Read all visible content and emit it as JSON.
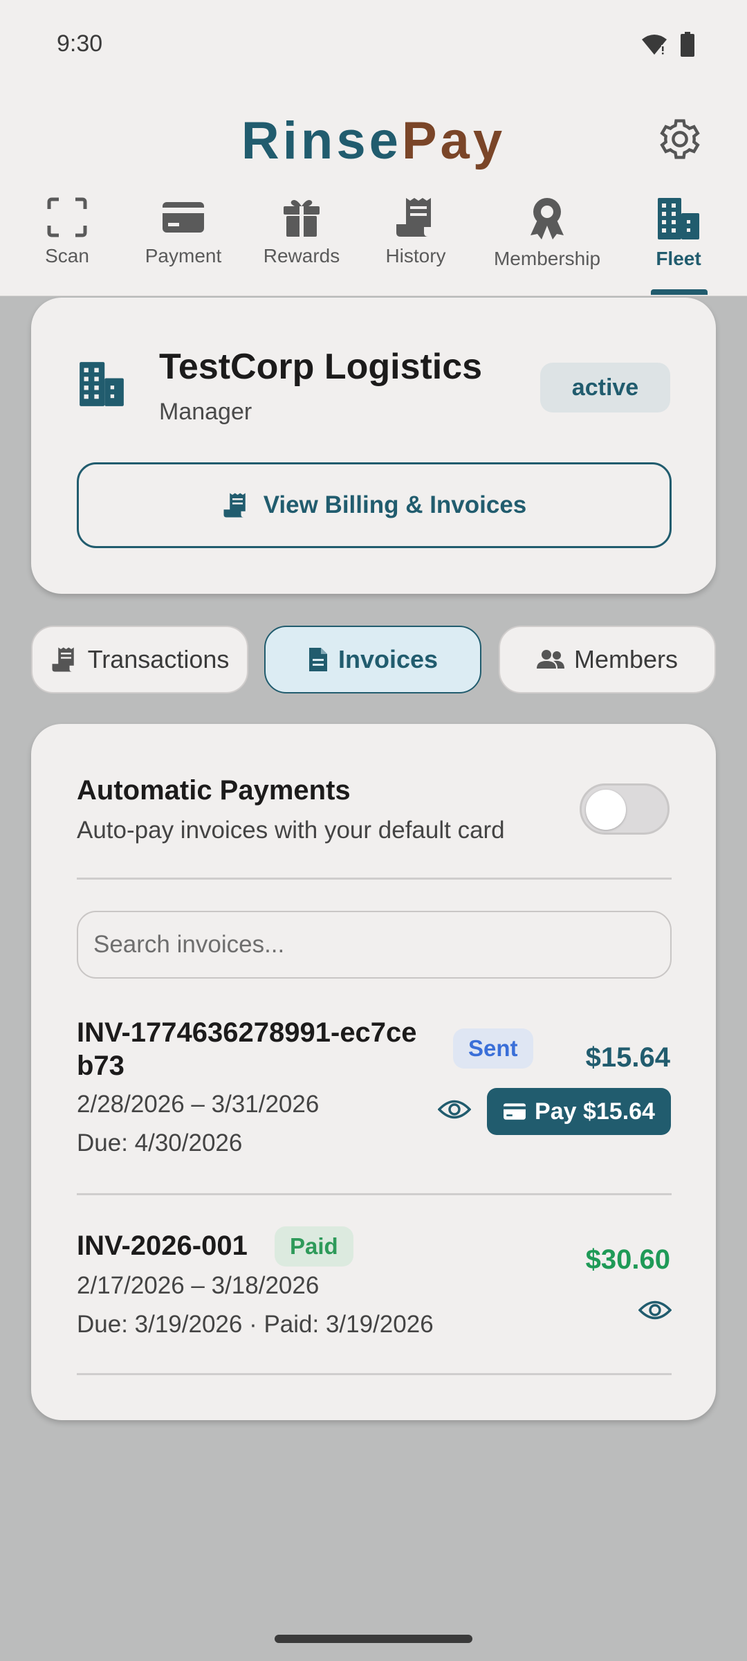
{
  "status_bar": {
    "time": "9:30"
  },
  "brand": {
    "part1": "Rinse",
    "part2": "Pay"
  },
  "nav": [
    {
      "label": "Scan",
      "icon": "scan-icon",
      "active": false
    },
    {
      "label": "Payment",
      "icon": "card-icon",
      "active": false
    },
    {
      "label": "Rewards",
      "icon": "gift-icon",
      "active": false
    },
    {
      "label": "History",
      "icon": "receipt-icon",
      "active": false
    },
    {
      "label": "Membership",
      "icon": "badge-icon",
      "active": false
    },
    {
      "label": "Fleet",
      "icon": "building-icon",
      "active": true
    }
  ],
  "fleet": {
    "company": "TestCorp Logistics",
    "role": "Manager",
    "status": "active",
    "billing_button": "View Billing & Invoices"
  },
  "segments": [
    {
      "label": "Transactions",
      "active": false
    },
    {
      "label": "Invoices",
      "active": true
    },
    {
      "label": "Members",
      "active": false
    }
  ],
  "auto_pay": {
    "title": "Automatic Payments",
    "subtitle": "Auto-pay invoices with your default card",
    "enabled": false
  },
  "search": {
    "placeholder": "Search invoices..."
  },
  "invoices": [
    {
      "id_line1": "INV-1774636278991-ec7ce",
      "id_line2": "b73",
      "status": "Sent",
      "amount": "$15.64",
      "period": "2/28/2026 – 3/31/2026",
      "due": "Due: 4/30/2026",
      "pay_label": "Pay $15.64"
    },
    {
      "id_line1": "INV-2026-001",
      "status": "Paid",
      "amount": "$30.60",
      "period": "2/17/2026 – 3/18/2026",
      "due": "Due: 3/19/2026 · Paid: 3/19/2026"
    }
  ],
  "colors": {
    "primary": "#215c6e",
    "brand_accent": "#7a4528",
    "paid_green": "#1f9a57",
    "sent_blue": "#3a6fd8"
  }
}
